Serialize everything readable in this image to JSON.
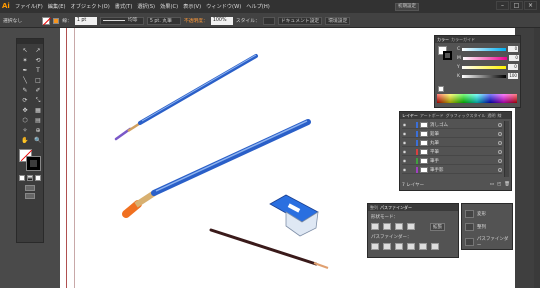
{
  "app": {
    "logo": "Ai",
    "menu": [
      "ファイル(F)",
      "編集(E)",
      "オブジェクト(O)",
      "書式(T)",
      "選択(S)",
      "効果(C)",
      "表示(V)",
      "ウィンドウ(W)",
      "ヘルプ(H)"
    ],
    "right_buttons": [
      "初期設定",
      "初期設定"
    ],
    "window_buttons": [
      "–",
      "□",
      "×"
    ]
  },
  "control_bar": {
    "selection": "選択なし",
    "stroke_label": "線：",
    "stroke_width": "1 pt",
    "stroke_profile": "均等",
    "brush": "5 pt. 丸筆",
    "opacity_label": "不透明度：",
    "opacity": "100%",
    "style_label": "スタイル：",
    "doc_setup": "ドキュメント設定",
    "prefs": "環境設定"
  },
  "tools": [
    "↖",
    "↗",
    "✶",
    "⟲",
    "✒",
    "T",
    "╲",
    "□",
    "✎",
    "✐",
    "⟳",
    "⤡",
    "✥",
    "▦",
    "⬡",
    "▤",
    "✧",
    "⊕",
    "✋",
    "🔍"
  ],
  "color_panel": {
    "tabs": [
      "カラー",
      "カラーガイド"
    ],
    "rows": [
      {
        "label": "C",
        "value": "0"
      },
      {
        "label": "M",
        "value": "0"
      },
      {
        "label": "Y",
        "value": "0"
      },
      {
        "label": "K",
        "value": "100"
      }
    ],
    "bar_colors": [
      "#00aeef",
      "#ec008c",
      "#fff200",
      "#000000"
    ]
  },
  "layers_panel": {
    "tabs": [
      "レイヤー",
      "アートボード",
      "グラフィックスタイル",
      "透明",
      "線"
    ],
    "layers": [
      {
        "name": "消しゴム",
        "color": "#3b6fd8"
      },
      {
        "name": "鉛筆",
        "color": "#3b6fd8"
      },
      {
        "name": "丸筆",
        "color": "#3b6fd8"
      },
      {
        "name": "平筆",
        "color": "#d84040"
      },
      {
        "name": "筆手",
        "color": "#40a040"
      },
      {
        "name": "筆手影",
        "color": "#a040c0"
      }
    ],
    "footer": "7 レイヤー"
  },
  "pathfinder": {
    "tabs": [
      "整列",
      "パスファインダー"
    ],
    "shape_mode": "形状モード：",
    "expand": "拡張",
    "pathfinders": "パスファインダー："
  },
  "mini_panel": {
    "items": [
      "変形",
      "整列",
      "パスファインダー"
    ]
  }
}
